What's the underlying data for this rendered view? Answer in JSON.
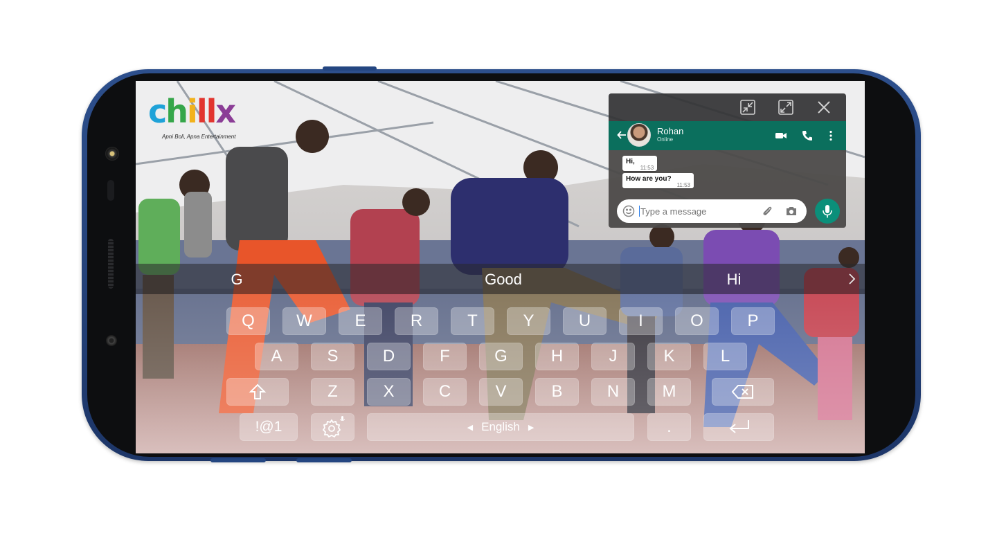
{
  "logo": {
    "name": "chillx",
    "tagline": "Apni Boli, Apna Entertainment"
  },
  "chat": {
    "contact_name": "Rohan",
    "contact_status": "Online",
    "messages": [
      {
        "text": "Hi,",
        "time": "11:53"
      },
      {
        "text": "How are you?",
        "time": "11:53"
      }
    ],
    "input_placeholder": "Type a message"
  },
  "suggestions": [
    "G",
    "Good",
    "Hi"
  ],
  "keyboard": {
    "row1": [
      "Q",
      "W",
      "E",
      "R",
      "T",
      "Y",
      "U",
      "I",
      "O",
      "P"
    ],
    "row2": [
      "A",
      "S",
      "D",
      "F",
      "G",
      "H",
      "J",
      "K",
      "L"
    ],
    "row3": [
      "Z",
      "X",
      "C",
      "V",
      "B",
      "N",
      "M"
    ],
    "symbols_label": "!@1",
    "language_label": "English",
    "period_label": "."
  },
  "colors": {
    "phone_frame": "#2d4f8c",
    "chat_header": "#0b6f5d",
    "mic_button": "#0b8f7a"
  }
}
